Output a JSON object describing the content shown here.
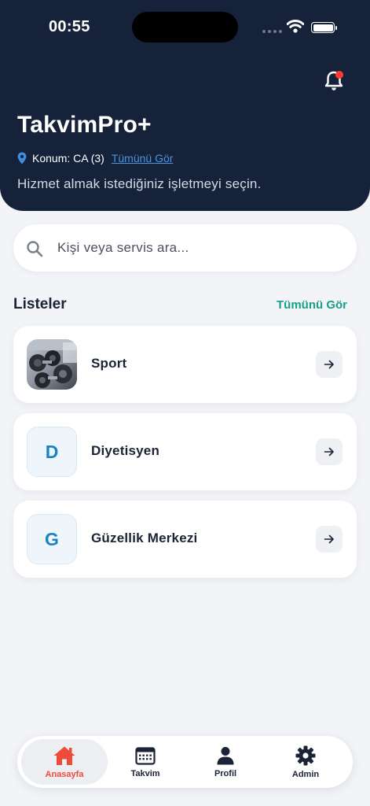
{
  "status_bar": {
    "time": "00:55"
  },
  "header": {
    "title": "TakvimPro+",
    "location_text": "Konum: CA (3)",
    "location_link": "Tümünü Gör",
    "subtitle": "Hizmet almak istediğiniz işletmeyi seçin."
  },
  "search": {
    "placeholder": "Kişi veya servis ara..."
  },
  "section": {
    "title": "Listeler",
    "link": "Tümünü Gör"
  },
  "lists": [
    {
      "label": "Sport",
      "thumb": "sport-photo"
    },
    {
      "label": "Diyetisyen",
      "letter": "D"
    },
    {
      "label": "Güzellik Merkezi",
      "letter": "G"
    }
  ],
  "bottom_nav": [
    {
      "label": "Anasayfa",
      "icon": "home-icon",
      "active": true
    },
    {
      "label": "Takvim",
      "icon": "calendar-icon",
      "active": false
    },
    {
      "label": "Profil",
      "icon": "person-icon",
      "active": false
    },
    {
      "label": "Admin",
      "icon": "gear-icon",
      "active": false
    }
  ],
  "colors": {
    "header_bg": "#16213a",
    "accent_link": "#1b9d87",
    "active_nav": "#ef4b3a",
    "notification_dot": "#ff3b30",
    "letter_color": "#1d82c4"
  }
}
